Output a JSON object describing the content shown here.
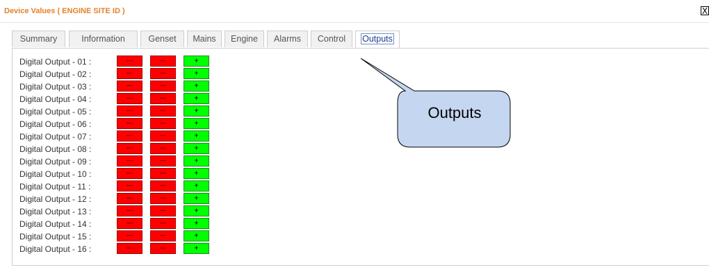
{
  "window": {
    "title": "Device Values ( ENGINE SITE ID )",
    "close_glyph": "X"
  },
  "tabs": [
    {
      "label": "Summary"
    },
    {
      "label": "Information"
    },
    {
      "label": "Genset"
    },
    {
      "label": "Mains"
    },
    {
      "label": "Engine"
    },
    {
      "label": "Alarms"
    },
    {
      "label": "Control"
    },
    {
      "label": "Outputs",
      "active": true
    }
  ],
  "outputs": {
    "rows": [
      {
        "label": "Digital Output - 01 :",
        "btn1": "---",
        "btn2": "---",
        "btn3": "+"
      },
      {
        "label": "Digital Output - 02 :",
        "btn1": "---",
        "btn2": "---",
        "btn3": "+"
      },
      {
        "label": "Digital Output - 03 :",
        "btn1": "---",
        "btn2": "---",
        "btn3": "+"
      },
      {
        "label": "Digital Output - 04 :",
        "btn1": "---",
        "btn2": "---",
        "btn3": "+"
      },
      {
        "label": "Digital Output - 05 :",
        "btn1": "---",
        "btn2": "---",
        "btn3": "+"
      },
      {
        "label": "Digital Output - 06 :",
        "btn1": "---",
        "btn2": "---",
        "btn3": "+"
      },
      {
        "label": "Digital Output - 07 :",
        "btn1": "---",
        "btn2": "---",
        "btn3": "+"
      },
      {
        "label": "Digital Output - 08 :",
        "btn1": "---",
        "btn2": "---",
        "btn3": "+"
      },
      {
        "label": "Digital Output - 09 :",
        "btn1": "---",
        "btn2": "---",
        "btn3": "+"
      },
      {
        "label": "Digital Output - 10 :",
        "btn1": "---",
        "btn2": "---",
        "btn3": "+"
      },
      {
        "label": "Digital Output - 11 :",
        "btn1": "---",
        "btn2": "---",
        "btn3": "+"
      },
      {
        "label": "Digital Output - 12 :",
        "btn1": "---",
        "btn2": "---",
        "btn3": "+"
      },
      {
        "label": "Digital Output - 13 :",
        "btn1": "---",
        "btn2": "---",
        "btn3": "+"
      },
      {
        "label": "Digital Output - 14 :",
        "btn1": "---",
        "btn2": "---",
        "btn3": "+"
      },
      {
        "label": "Digital Output - 15 :",
        "btn1": "---",
        "btn2": "---",
        "btn3": "+"
      },
      {
        "label": "Digital Output - 16 :",
        "btn1": "---",
        "btn2": "---",
        "btn3": "+"
      }
    ]
  },
  "callout": {
    "text": "Outputs"
  },
  "colors": {
    "title": "#e4812a",
    "off": "#ff0000",
    "on": "#00ff00",
    "callout_fill": "#c5d6f0"
  }
}
